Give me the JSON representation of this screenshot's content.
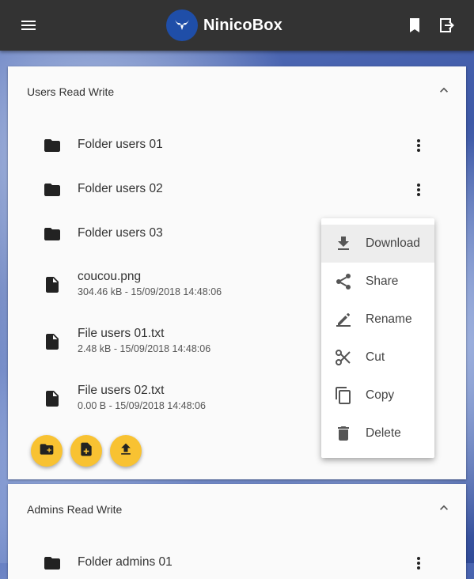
{
  "appbar": {
    "title": "NinicoBox",
    "menu_icon": "menu-icon",
    "bookmark_icon": "bookmark-icon",
    "logout_icon": "exit-to-app-icon",
    "background": "#333333"
  },
  "sections": [
    {
      "title": "Users Read Write",
      "items": [
        {
          "type": "folder",
          "name": "Folder users 01"
        },
        {
          "type": "folder",
          "name": "Folder users 02"
        },
        {
          "type": "folder",
          "name": "Folder users 03"
        },
        {
          "type": "file",
          "name": "coucou.png",
          "meta": "304.46 kB - 15/09/2018 14:48:06"
        },
        {
          "type": "file",
          "name": "File users 01.txt",
          "meta": "2.48 kB - 15/09/2018 14:48:06"
        },
        {
          "type": "file",
          "name": "File users 02.txt",
          "meta": "0.00 B - 15/09/2018 14:48:06"
        }
      ],
      "actions": [
        "create-folder-icon",
        "create-file-icon",
        "upload-icon"
      ]
    },
    {
      "title": "Admins Read Write",
      "items": [
        {
          "type": "folder",
          "name": "Folder admins 01"
        }
      ]
    }
  ],
  "context_menu": {
    "items": [
      {
        "label": "Download",
        "icon": "download-icon",
        "active": true
      },
      {
        "label": "Share",
        "icon": "share-icon"
      },
      {
        "label": "Rename",
        "icon": "edit-icon"
      },
      {
        "label": "Cut",
        "icon": "scissors-icon"
      },
      {
        "label": "Copy",
        "icon": "copy-icon"
      },
      {
        "label": "Delete",
        "icon": "trash-icon"
      }
    ]
  },
  "colors": {
    "fab": "#f8c232",
    "logo": "#1f4ea8",
    "menu_active": "#ededed"
  }
}
